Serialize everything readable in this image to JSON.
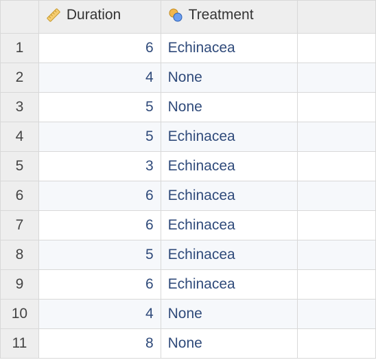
{
  "columns": {
    "duration": {
      "label": "Duration",
      "icon": "ruler-icon"
    },
    "treatment": {
      "label": "Treatment",
      "icon": "circles-icon"
    }
  },
  "rows": [
    {
      "n": "1",
      "duration": "6",
      "treatment": "Echinacea"
    },
    {
      "n": "2",
      "duration": "4",
      "treatment": "None"
    },
    {
      "n": "3",
      "duration": "5",
      "treatment": "None"
    },
    {
      "n": "4",
      "duration": "5",
      "treatment": "Echinacea"
    },
    {
      "n": "5",
      "duration": "3",
      "treatment": "Echinacea"
    },
    {
      "n": "6",
      "duration": "6",
      "treatment": "Echinacea"
    },
    {
      "n": "7",
      "duration": "6",
      "treatment": "Echinacea"
    },
    {
      "n": "8",
      "duration": "5",
      "treatment": "Echinacea"
    },
    {
      "n": "9",
      "duration": "6",
      "treatment": "Echinacea"
    },
    {
      "n": "10",
      "duration": "4",
      "treatment": "None"
    },
    {
      "n": "11",
      "duration": "8",
      "treatment": "None"
    }
  ]
}
